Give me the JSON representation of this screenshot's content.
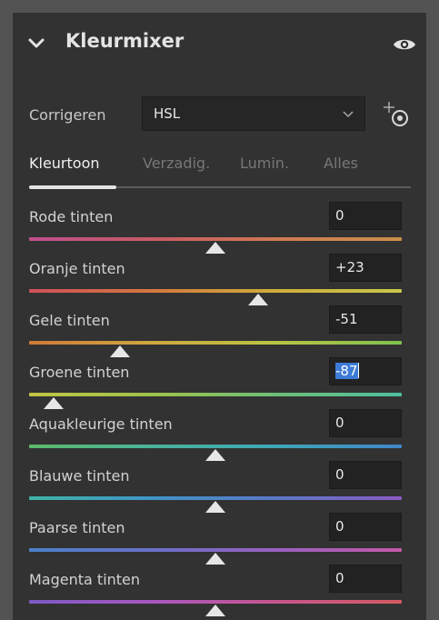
{
  "panel": {
    "title": "Kleurmixer",
    "visible_toggle": "eye-icon",
    "collapse_icon": "chevron-down-icon"
  },
  "adjust": {
    "label": "Corrigeren",
    "value": "HSL",
    "target_tool_icon": "target-adjustment-icon"
  },
  "tabs": [
    {
      "label": "Kleurtoon",
      "active": true
    },
    {
      "label": "Verzadig.",
      "active": false
    },
    {
      "label": "Lumin.",
      "active": false
    },
    {
      "label": "Alles",
      "active": false
    }
  ],
  "sliders": [
    {
      "label": "Rode tinten",
      "value": "0",
      "level": 0,
      "gradient": [
        "#c0508f",
        "#c85a64",
        "#cf7a52",
        "#c98f4a"
      ]
    },
    {
      "label": "Oranje tinten",
      "value": "+23",
      "level": 23,
      "gradient": [
        "#d0505a",
        "#d4783e",
        "#cfae3a",
        "#c9c84a"
      ]
    },
    {
      "label": "Gele tinten",
      "value": "-51",
      "level": -51,
      "gradient": [
        "#cf7a3a",
        "#cfa83e",
        "#b9c444",
        "#7ec24e"
      ]
    },
    {
      "label": "Groene tinten",
      "value": "-87",
      "level": -87,
      "selected": true,
      "gradient": [
        "#c2c443",
        "#9dc24a",
        "#6dbf78",
        "#4ebfa0"
      ]
    },
    {
      "label": "Aquakleurige tinten",
      "value": "0",
      "level": 0,
      "gradient": [
        "#5cba6a",
        "#49b39a",
        "#3fa6b8",
        "#3f86c9"
      ]
    },
    {
      "label": "Blauwe tinten",
      "value": "0",
      "level": 0,
      "gradient": [
        "#3fb4a8",
        "#3f95c8",
        "#5b78c9",
        "#8a5bc2"
      ]
    },
    {
      "label": "Paarse tinten",
      "value": "0",
      "level": 0,
      "gradient": [
        "#4a82c9",
        "#6a70c8",
        "#9a60c0",
        "#c458a8"
      ]
    },
    {
      "label": "Magenta tinten",
      "value": "0",
      "level": 0,
      "gradient": [
        "#7c5ac4",
        "#a957c0",
        "#c8568e",
        "#d45a62"
      ]
    }
  ],
  "colors": {
    "background": "#535353",
    "panel": "#323232",
    "selection": "#3d7bd6"
  }
}
